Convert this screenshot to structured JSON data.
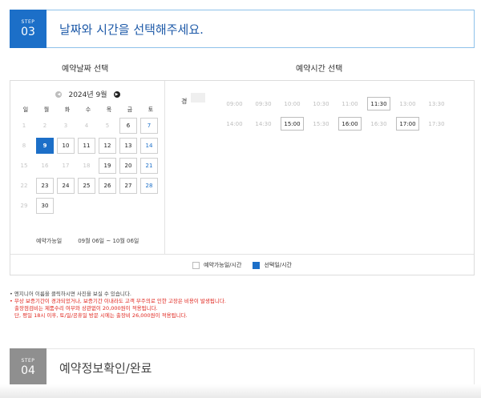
{
  "step3": {
    "label": "STEP",
    "number": "03",
    "title": "날짜와 시간을 선택해주세요."
  },
  "date_col_title": "예약날짜 선택",
  "time_col_title": "예약시간 선택",
  "calendar": {
    "month_label": "2024년 9월",
    "weekdays": [
      "일",
      "월",
      "화",
      "수",
      "목",
      "금",
      "토"
    ],
    "weeks": [
      [
        "1",
        "2",
        "3",
        "4",
        "5",
        "6",
        "7"
      ],
      [
        "8",
        "9",
        "10",
        "11",
        "12",
        "13",
        "14"
      ],
      [
        "15",
        "16",
        "17",
        "18",
        "19",
        "20",
        "21"
      ],
      [
        "22",
        "23",
        "24",
        "25",
        "26",
        "27",
        "28"
      ],
      [
        "29",
        "30",
        "",
        "",
        "",
        "",
        ""
      ]
    ],
    "available": [
      "6",
      "7",
      "9",
      "10",
      "11",
      "12",
      "13",
      "14",
      "19",
      "20",
      "21",
      "23",
      "24",
      "25",
      "26",
      "27",
      "28",
      "30"
    ],
    "saturday_blue": [
      "7",
      "14",
      "21",
      "28"
    ],
    "selected": "9",
    "range_label": "예약가능일",
    "range_value": "09월 06일 ~ 10월 06일"
  },
  "time_panel": {
    "prefix": "경",
    "rows": [
      [
        "09:00",
        "09:30",
        "10:00",
        "10:30",
        "11:00",
        "11:30",
        "13:00",
        "13:30"
      ],
      [
        "14:00",
        "14:30",
        "15:00",
        "15:30",
        "16:00",
        "16:30",
        "17:00",
        "17:30"
      ]
    ],
    "available": [
      "11:30",
      "15:00",
      "16:00",
      "17:00"
    ]
  },
  "legend": {
    "available": "예약가능일/시간",
    "selected": "선택일/시간"
  },
  "notes": {
    "line1": "• 엔지니어 이름을 클릭하시면 사진을 보실 수 있습니다.",
    "line2": "• 무상 보증기간이 경과되었거나, 보증기간 이내라도 고객 부주의로 인한 고장은 비용이 발생됩니다.",
    "line3": "출장점검비는 제품수리 여부와 상관없이 20,000원이 적용됩니다.",
    "line4": "단, 평일 18시 이후, 토/일/공휴일 방문 시에는 출장비 26,000원이 적용됩니다."
  },
  "step4": {
    "label": "STEP",
    "number": "04",
    "title": "예약정보확인/완료"
  },
  "colors": {
    "accent": "#1c6fc8",
    "saturday": "#1c6fc8",
    "notice_red": "#e0251d",
    "step4_badge": "#8f8f8f"
  }
}
